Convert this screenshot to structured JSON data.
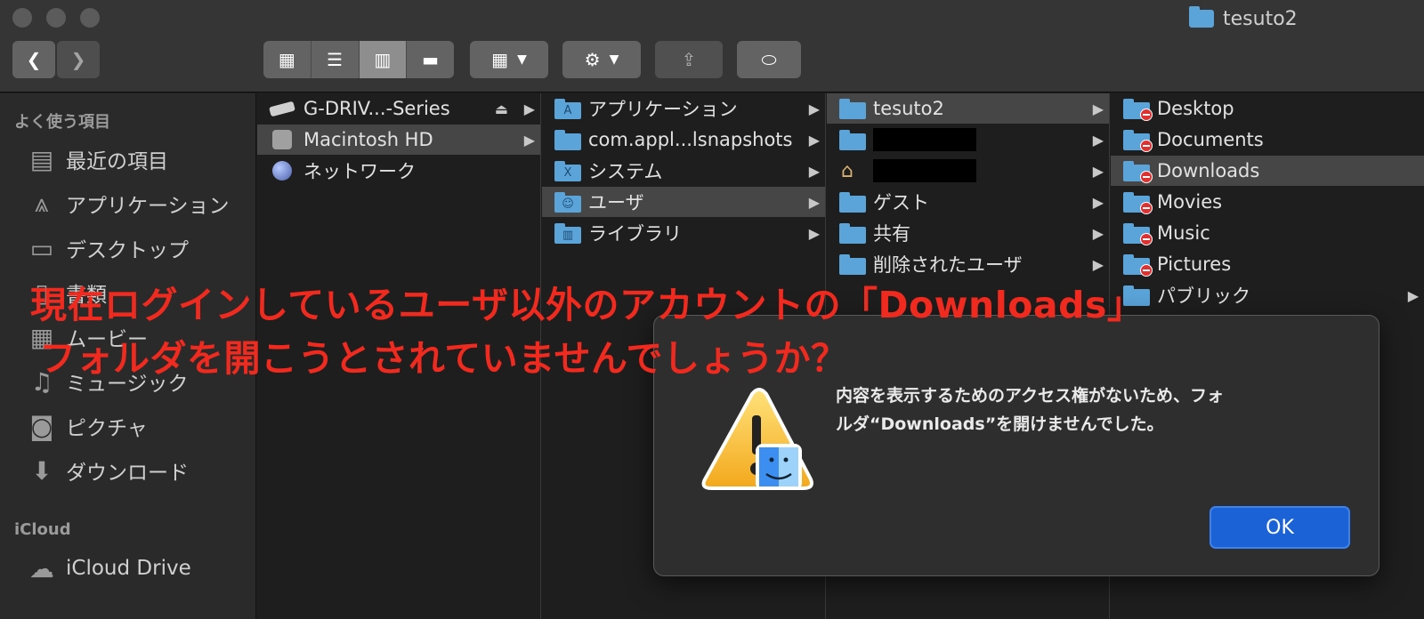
{
  "window": {
    "title": "tesuto2"
  },
  "sidebar": {
    "favorites_header": "よく使う項目",
    "favorites": [
      {
        "label": "最近の項目",
        "icon": "recents-icon"
      },
      {
        "label": "アプリケーション",
        "icon": "applications-icon"
      },
      {
        "label": "デスクトップ",
        "icon": "desktop-icon"
      },
      {
        "label": "書類",
        "icon": "documents-icon"
      },
      {
        "label": "ムービー",
        "icon": "movies-icon"
      },
      {
        "label": "ミュージック",
        "icon": "music-icon"
      },
      {
        "label": "ピクチャ",
        "icon": "pictures-icon"
      },
      {
        "label": "ダウンロード",
        "icon": "downloads-icon"
      }
    ],
    "icloud_header": "iCloud",
    "icloud": [
      {
        "label": "iCloud Drive",
        "icon": "cloud-icon"
      }
    ]
  },
  "columns": {
    "col1": [
      {
        "label": "G-DRIV...-Series",
        "icon": "external-drive-icon"
      },
      {
        "label": "Macintosh HD",
        "icon": "hard-disk-icon"
      },
      {
        "label": "ネットワーク",
        "icon": "network-icon"
      }
    ],
    "col2": [
      {
        "label": "アプリケーション"
      },
      {
        "label": "com.appl...lsnapshots"
      },
      {
        "label": "システム"
      },
      {
        "label": "ユーザ"
      },
      {
        "label": "ライブラリ"
      }
    ],
    "col3": [
      {
        "label": "tesuto2"
      },
      {
        "label": ""
      },
      {
        "label": ""
      },
      {
        "label": "ゲスト"
      },
      {
        "label": "共有"
      },
      {
        "label": "削除されたユーザ"
      }
    ],
    "col4": [
      {
        "label": "Desktop"
      },
      {
        "label": "Documents"
      },
      {
        "label": "Downloads"
      },
      {
        "label": "Movies"
      },
      {
        "label": "Music"
      },
      {
        "label": "Pictures"
      },
      {
        "label": "パブリック"
      }
    ]
  },
  "caption": {
    "line1": "現在ログインしているユーザ以外のアカウントの「Downloads」",
    "line2": "フォルダを開こうとされていませんでしょうか？"
  },
  "dialog": {
    "message_line1": "内容を表示するためのアクセス権がないため、フォ",
    "message_line2": "ルダ“Downloads”を開けませんでした。",
    "ok_label": "OK"
  }
}
